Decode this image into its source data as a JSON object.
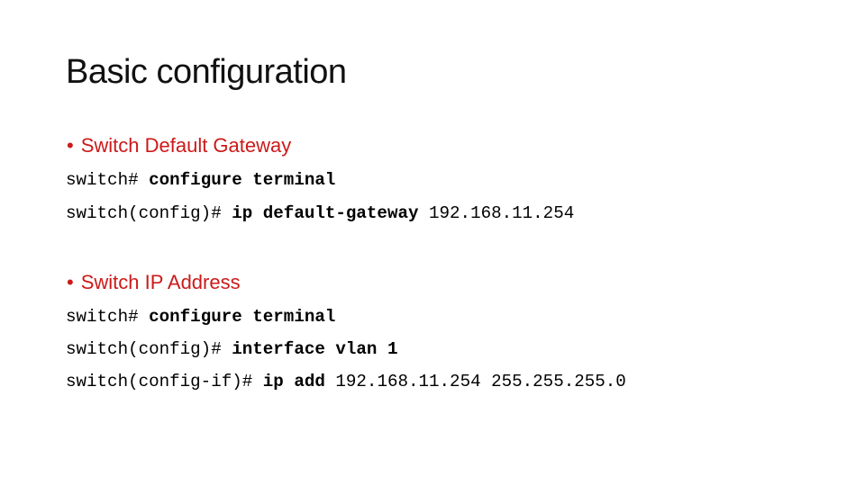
{
  "slide": {
    "title": "Basic configuration",
    "accent_color": "#cc1a1a",
    "sections": [
      {
        "bullet": "Switch Default Gateway",
        "lines": [
          {
            "prompt": "switch# ",
            "command": "configure terminal",
            "args": ""
          },
          {
            "prompt": "switch(config)# ",
            "command": "ip default-gateway ",
            "args": "192.168.11.254"
          }
        ]
      },
      {
        "bullet": "Switch IP Address",
        "lines": [
          {
            "prompt": "switch# ",
            "command": "configure terminal",
            "args": ""
          },
          {
            "prompt": "switch(config)# ",
            "command": "interface vlan 1",
            "args": ""
          },
          {
            "prompt": "switch(config-if)# ",
            "command": "ip add ",
            "args": "192.168.11.254 255.255.255.0"
          }
        ]
      }
    ]
  },
  "bullet_glyph": "•"
}
